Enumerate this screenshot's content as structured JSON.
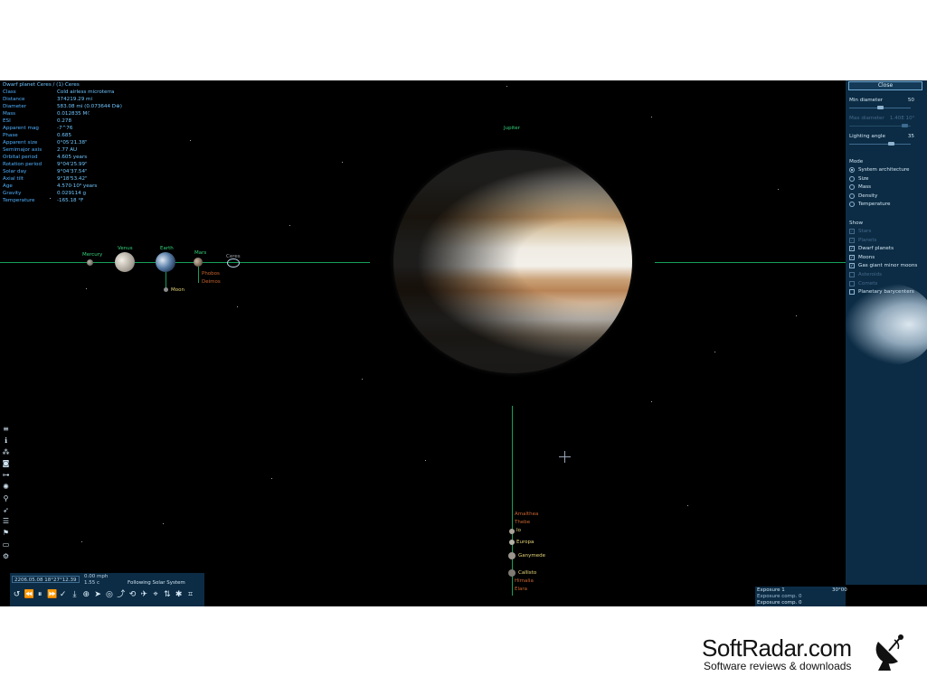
{
  "info_panel": {
    "title": "Dwarf planet  Ceres / (1) Ceres",
    "rows": [
      {
        "k": "Class",
        "v": "Cold airless microterra"
      },
      {
        "k": "Distance",
        "v": "374219.29 mi"
      },
      {
        "k": "Diameter",
        "v": "583.08 mi (0.073644 D⊕)"
      },
      {
        "k": "Mass",
        "v": "0.012835 M☾"
      },
      {
        "k": "ESI",
        "v": "0.278"
      },
      {
        "k": "Apparent mag",
        "v": "-7^76"
      },
      {
        "k": "Phase",
        "v": "0.685"
      },
      {
        "k": "Apparent size",
        "v": "0°05'21.38\""
      },
      {
        "k": "Semimajor axis",
        "v": "2.77 AU"
      },
      {
        "k": "Orbital period",
        "v": "4.605 years"
      },
      {
        "k": "Rotation period",
        "v": "9°04'25.99\""
      },
      {
        "k": "Solar day",
        "v": "9°04'37.54\""
      },
      {
        "k": "Axial tilt",
        "v": "9°18'53.42\""
      },
      {
        "k": "Age",
        "v": "4.570·10⁹ years"
      },
      {
        "k": "Gravity",
        "v": "0.029114 g"
      },
      {
        "k": "Temperature",
        "v": "-165.18 °F"
      }
    ]
  },
  "labels": {
    "jupiter": "Jupiter",
    "mercury": "Mercury",
    "venus": "Venus",
    "earth": "Earth",
    "mars": "Mars",
    "ceres": "Ceres",
    "moon": "Moon",
    "phobos": "Phobos",
    "deimos": "Deimos",
    "amalthea": "Amalthea",
    "thebe": "Thebe",
    "io": "Io",
    "europa": "Europa",
    "ganymede": "Ganymede",
    "callisto": "Callisto",
    "himalia": "Himalia",
    "elara": "Elara"
  },
  "settings_panel": {
    "close_label": "Close",
    "min_diameter": {
      "label": "Min diameter",
      "value": "50",
      "fraction": 0.5
    },
    "max_diameter": {
      "label": "Max diameter",
      "value": "1.40E 10³",
      "fraction": 0.95
    },
    "lighting_angle": {
      "label": "Lighting angle",
      "value": "35",
      "fraction": 0.7
    },
    "mode_heading": "Mode",
    "modes": [
      {
        "label": "System architecture",
        "selected": true
      },
      {
        "label": "Size",
        "selected": false
      },
      {
        "label": "Mass",
        "selected": false
      },
      {
        "label": "Density",
        "selected": false
      },
      {
        "label": "Temperature",
        "selected": false
      }
    ],
    "show_heading": "Show",
    "show_items": [
      {
        "label": "Stars",
        "checked": true,
        "enabled": false
      },
      {
        "label": "Planets",
        "checked": true,
        "enabled": false
      },
      {
        "label": "Dwarf planets",
        "checked": true,
        "enabled": true
      },
      {
        "label": "Moons",
        "checked": true,
        "enabled": true
      },
      {
        "label": "Gas giant minor moons",
        "checked": true,
        "enabled": true
      },
      {
        "label": "Asteroids",
        "checked": false,
        "enabled": false
      },
      {
        "label": "Comets",
        "checked": false,
        "enabled": false
      },
      {
        "label": "Planetary barycenters",
        "checked": false,
        "enabled": true
      }
    ]
  },
  "bottom_bar": {
    "datetime": "2206.05.08 18°27°12.39",
    "speed_line1": "0.00 mph",
    "speed_line2": "1.55 c",
    "following": "Following Solar System"
  },
  "exposure": {
    "line1_label": "Exposure 1",
    "line1_value": "30°00",
    "line2": "Exposure comp. 0",
    "line3": "Exposure comp. 0"
  },
  "watermark": {
    "brand": "SoftRadar.com",
    "tagline": "Software reviews & downloads"
  },
  "toolbar_icons": [
    "menu-icon",
    "info-icon",
    "planet-system-icon",
    "camera-icon",
    "orbit-icon",
    "galaxy-icon",
    "search-icon",
    "ship-icon",
    "list-icon",
    "flag-icon",
    "display-icon",
    "gear-icon"
  ],
  "bottom_icons": [
    "time-reverse-icon",
    "rewind-icon",
    "pause-icon",
    "forward-icon",
    "checkmark-icon",
    "landing-icon",
    "select-icon",
    "go-to-icon",
    "track-icon",
    "follow-icon",
    "orbit-camera-icon",
    "free-camera-icon",
    "lock-icon",
    "sync-icon",
    "star-icon",
    "map-icon"
  ]
}
